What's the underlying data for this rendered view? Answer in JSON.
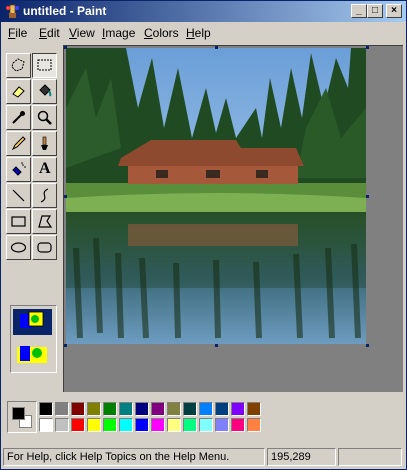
{
  "window": {
    "title": "untitled - Paint"
  },
  "caption_buttons": {
    "minimize": "_",
    "maximize": "□",
    "close": "×"
  },
  "menu": [
    {
      "label": "File",
      "accel": "F"
    },
    {
      "label": "Edit",
      "accel": "E"
    },
    {
      "label": "View",
      "accel": "V"
    },
    {
      "label": "Image",
      "accel": "I"
    },
    {
      "label": "Colors",
      "accel": "C"
    },
    {
      "label": "Help",
      "accel": "H"
    }
  ],
  "tools": [
    {
      "name": "free-form-select",
      "icon": "free-form-select-icon"
    },
    {
      "name": "select",
      "icon": "select-icon",
      "active": true
    },
    {
      "name": "eraser",
      "icon": "eraser-icon"
    },
    {
      "name": "fill",
      "icon": "fill-bucket-icon"
    },
    {
      "name": "pick-color",
      "icon": "eyedropper-icon"
    },
    {
      "name": "magnifier",
      "icon": "magnifier-icon"
    },
    {
      "name": "pencil",
      "icon": "pencil-icon"
    },
    {
      "name": "brush",
      "icon": "brush-icon"
    },
    {
      "name": "airbrush",
      "icon": "airbrush-icon"
    },
    {
      "name": "text",
      "icon": "text-icon",
      "glyph": "A"
    },
    {
      "name": "line",
      "icon": "line-icon"
    },
    {
      "name": "curve",
      "icon": "curve-icon"
    },
    {
      "name": "rectangle",
      "icon": "rectangle-icon"
    },
    {
      "name": "polygon",
      "icon": "polygon-icon"
    },
    {
      "name": "ellipse",
      "icon": "ellipse-icon"
    },
    {
      "name": "rounded-rectangle",
      "icon": "rounded-rectangle-icon"
    }
  ],
  "selection_options": [
    "opaque-selection",
    "transparent-selection"
  ],
  "colors": {
    "foreground": "#000000",
    "background": "#ffffff",
    "palette_row1": [
      "#000000",
      "#808080",
      "#800000",
      "#808000",
      "#008000",
      "#008080",
      "#000080",
      "#800080",
      "#808040",
      "#004040",
      "#0080ff",
      "#004080",
      "#8000ff",
      "#804000"
    ],
    "palette_row2": [
      "#ffffff",
      "#c0c0c0",
      "#ff0000",
      "#ffff00",
      "#00ff00",
      "#00ffff",
      "#0000ff",
      "#ff00ff",
      "#ffff80",
      "#00ff80",
      "#80ffff",
      "#8080ff",
      "#ff0080",
      "#ff8040"
    ]
  },
  "status": {
    "help": "For Help, click Help Topics on the Help Menu.",
    "coords": "195,289"
  }
}
